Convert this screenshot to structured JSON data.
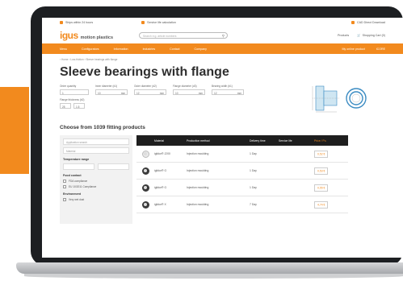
{
  "topbar": {
    "ship": "Ships within 24 hours",
    "lifetime": "Service life calculation",
    "cad": "CAD Direct Download"
  },
  "header": {
    "logo": "igus",
    "logo_sub": "motion plastics",
    "search_placeholder": "Search e.g. article numbers",
    "product_link": "Products",
    "cart": "Shopping Cart (0)"
  },
  "nav": {
    "items": [
      "Menu",
      "Configurators",
      "Information",
      "Industries",
      "Contact",
      "Company"
    ],
    "right": [
      "My online product",
      "iCORE"
    ]
  },
  "breadcrumb": "‹ Home › Low-friction › Sleeve bearings with flange",
  "page_title": "Sleeve bearings with flange",
  "filters": {
    "order_quantity": {
      "label": "Order quantity",
      "value": "1"
    },
    "inner_diameter": {
      "label": "Inner diameter (d1)",
      "from": "10",
      "unit": "mm"
    },
    "outer_diameter": {
      "label": "Outer diameter (d2)",
      "from": "12",
      "unit": "mm"
    },
    "flange_diameter": {
      "label": "Flange diameter (d3)",
      "from": "10",
      "unit": "mm"
    },
    "bearing_width": {
      "label": "Bearing width (b1)",
      "from": "12",
      "unit": "mm"
    },
    "flange_thickness": {
      "label": "Flange thickness (b2)",
      "from": "25",
      "to": "1.5"
    }
  },
  "choose_heading": "Choose from 1039 fitting products",
  "sidebar": {
    "select": "Application search",
    "search": "Material",
    "temp_heading": "Temperature range",
    "temp_from": "",
    "temp_to": "",
    "food_heading": "Food contact",
    "food_options": [
      "FDA compliance",
      "EU 10/2011 Compliance"
    ],
    "env_heading": "Environment",
    "env_options": [
      "Very wet dust"
    ]
  },
  "table": {
    "headers": [
      "",
      "Material",
      "Production method",
      "Delivery time",
      "Service life",
      "Price / Pc."
    ],
    "rows": [
      {
        "icon": "light",
        "material": "iglidur® J200",
        "method": "Injection moulding",
        "delivery": "1 Day",
        "price": "0,52 €"
      },
      {
        "icon": "dark",
        "material": "iglidur® G",
        "method": "Injection moulding",
        "delivery": "1 Day",
        "price": "0,53 €"
      },
      {
        "icon": "dark",
        "material": "iglidur® G",
        "method": "Injection moulding",
        "delivery": "1 Day",
        "price": "0,55 €"
      },
      {
        "icon": "dark",
        "material": "iglidur® X",
        "method": "Injection moulding",
        "delivery": "7 Day",
        "price": "4,74 €"
      }
    ]
  },
  "colors": {
    "accent": "#f28a1e",
    "dark": "#1e1e1e"
  }
}
